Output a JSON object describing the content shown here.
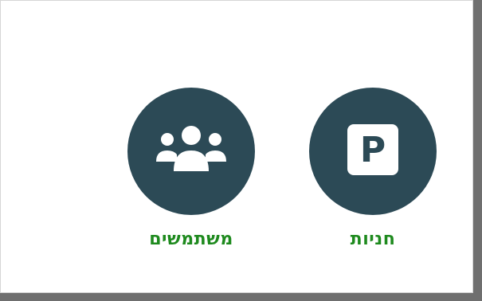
{
  "tiles": [
    {
      "label": "חניות",
      "icon": "parking-icon"
    },
    {
      "label": "משתמשים",
      "icon": "users-icon"
    }
  ],
  "colors": {
    "circle": "#2c4a56",
    "label": "#1e8a1e",
    "background": "#ffffff"
  }
}
